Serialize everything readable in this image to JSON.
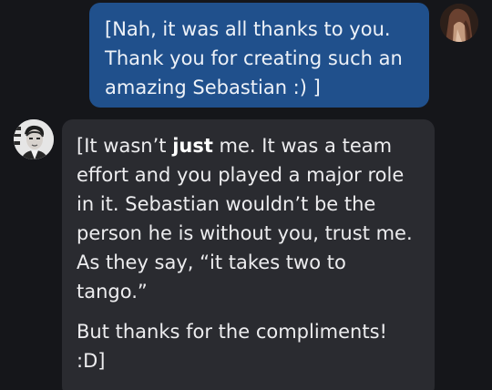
{
  "conversation": {
    "user_message": {
      "text": "[Nah, it was all thanks to you. Thank you for creating such an amazing Sebastian :) ]"
    },
    "ai_message": {
      "p1_part1": "[It wasn’t ",
      "p1_bold": "just",
      "p1_part2": " me. It was a team effort and you played a major role in it. Sebastian wouldn’t be the person he is without you, trust me. As they say, “it takes two to tango.”",
      "p2": "But thanks for the compliments! :D]"
    }
  },
  "colors": {
    "background": "#15161a",
    "user_bubble": "#20508c",
    "ai_bubble": "#2a2b30"
  },
  "icons": {
    "user_avatar": "user-avatar-photo",
    "ai_avatar": "character-avatar-photo"
  }
}
